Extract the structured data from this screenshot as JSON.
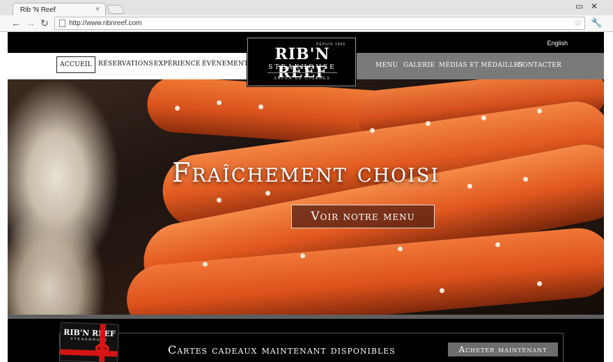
{
  "browser": {
    "tab_title": "Rib 'N Reef",
    "tab_close": "×",
    "url": "http://www.ribnreef.com",
    "back": "←",
    "forward": "→",
    "reload": "↻",
    "star": "☆",
    "wrench": "🔧",
    "minimize": "▭",
    "close": "✕"
  },
  "site": {
    "language_link": "English",
    "nav_left": [
      "Accueil",
      "Réservations",
      "Expérience",
      "Événements"
    ],
    "nav_right": [
      "Menu",
      "Galerie",
      "Médias et médailles",
      "Contacter"
    ],
    "active_item": "Accueil",
    "logo": {
      "depuis": "DEPUIS 1966",
      "main": "RIB'N REEF",
      "registered": "®",
      "sub": "STEAKHOUSE",
      "tagline": "SALON DE CIGARES"
    },
    "hero": {
      "title": "Fraîchement choisi",
      "button": "Voir notre menu"
    },
    "gift": {
      "card_logo": "RIB'N REEF",
      "card_sub": "STEAKHOUSE",
      "text": "Cartes cadeaux maintenant disponibles",
      "button": "Acheter maintenant"
    }
  },
  "colors": {
    "nav_right_bg": "#7a7a7a",
    "crab_orange": "#e2571f",
    "ribbon_red": "#d41414",
    "buy_button_bg": "#6d6d6d"
  }
}
